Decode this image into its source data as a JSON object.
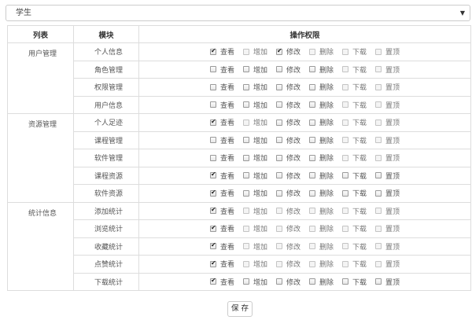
{
  "role_select": {
    "value": "学生"
  },
  "table": {
    "headers": {
      "list": "列表",
      "module": "模块",
      "permissions": "操作权限"
    },
    "permission_labels": [
      "查看",
      "增加",
      "修改",
      "删除",
      "下载",
      "置顶"
    ],
    "groups": [
      {
        "name": "用户管理",
        "modules": [
          {
            "name": "个人信息",
            "checked": [
              true,
              false,
              true,
              false,
              false,
              false
            ],
            "disabled": [
              false,
              true,
              false,
              true,
              true,
              true
            ]
          },
          {
            "name": "角色管理",
            "checked": [
              false,
              false,
              false,
              false,
              false,
              false
            ],
            "disabled": [
              false,
              false,
              false,
              false,
              true,
              true
            ]
          },
          {
            "name": "权限管理",
            "checked": [
              false,
              false,
              false,
              false,
              false,
              false
            ],
            "disabled": [
              false,
              false,
              false,
              false,
              true,
              true
            ]
          },
          {
            "name": "用户信息",
            "checked": [
              false,
              false,
              false,
              false,
              false,
              false
            ],
            "disabled": [
              false,
              false,
              false,
              false,
              true,
              true
            ]
          }
        ]
      },
      {
        "name": "资源管理",
        "modules": [
          {
            "name": "个人足迹",
            "checked": [
              true,
              false,
              false,
              false,
              false,
              false
            ],
            "disabled": [
              false,
              true,
              false,
              false,
              true,
              true
            ]
          },
          {
            "name": "课程管理",
            "checked": [
              false,
              false,
              false,
              false,
              false,
              false
            ],
            "disabled": [
              false,
              false,
              false,
              false,
              true,
              true
            ]
          },
          {
            "name": "软件管理",
            "checked": [
              false,
              false,
              false,
              false,
              false,
              false
            ],
            "disabled": [
              false,
              false,
              false,
              false,
              true,
              true
            ]
          },
          {
            "name": "课程资源",
            "checked": [
              true,
              false,
              false,
              false,
              false,
              false
            ],
            "disabled": [
              false,
              false,
              false,
              false,
              false,
              false
            ]
          },
          {
            "name": "软件资源",
            "checked": [
              true,
              false,
              false,
              false,
              false,
              false
            ],
            "disabled": [
              false,
              false,
              false,
              false,
              false,
              false
            ]
          }
        ]
      },
      {
        "name": "统计信息",
        "modules": [
          {
            "name": "添加统计",
            "checked": [
              true,
              false,
              false,
              false,
              false,
              false
            ],
            "disabled": [
              false,
              true,
              true,
              true,
              true,
              true
            ]
          },
          {
            "name": "浏览统计",
            "checked": [
              true,
              false,
              false,
              false,
              false,
              false
            ],
            "disabled": [
              false,
              true,
              true,
              true,
              true,
              true
            ]
          },
          {
            "name": "收藏统计",
            "checked": [
              true,
              false,
              false,
              false,
              false,
              false
            ],
            "disabled": [
              false,
              true,
              true,
              true,
              true,
              true
            ]
          },
          {
            "name": "点赞统计",
            "checked": [
              true,
              false,
              false,
              false,
              false,
              false
            ],
            "disabled": [
              false,
              true,
              true,
              true,
              true,
              true
            ]
          },
          {
            "name": "下载统计",
            "checked": [
              true,
              false,
              false,
              false,
              false,
              false
            ],
            "disabled": [
              false,
              false,
              false,
              false,
              false,
              false
            ]
          }
        ]
      }
    ]
  },
  "save_button": {
    "label": "保 存"
  }
}
